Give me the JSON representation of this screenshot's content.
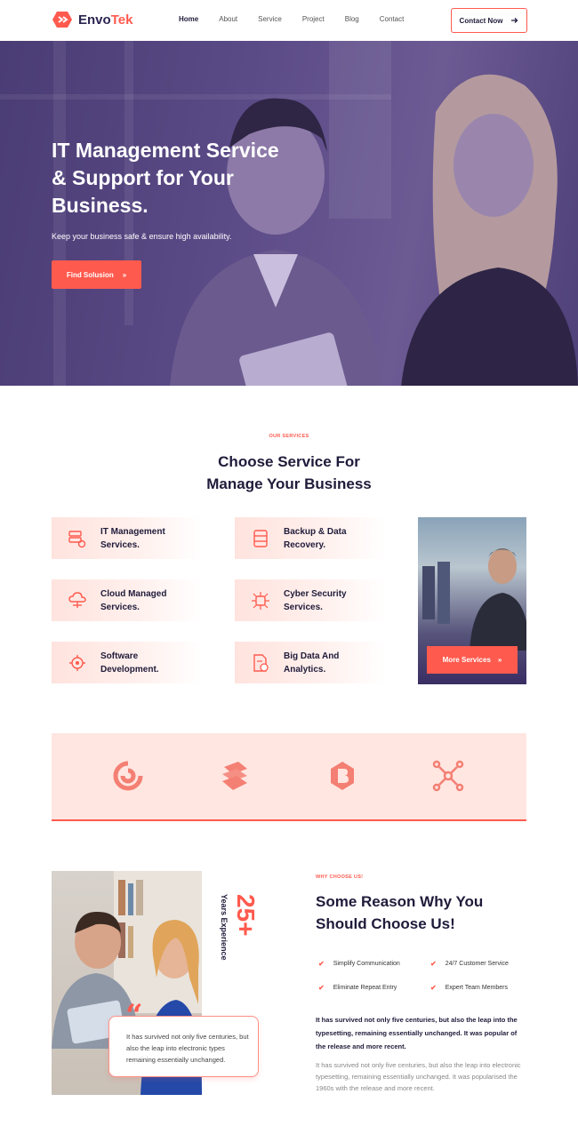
{
  "nav": {
    "brand_a": "Envo",
    "brand_b": "Tek",
    "items": [
      {
        "label": "Home"
      },
      {
        "label": "About"
      },
      {
        "label": "Service"
      },
      {
        "label": "Project"
      },
      {
        "label": "Blog"
      },
      {
        "label": "Contact"
      }
    ],
    "cta": "Contact Now",
    "cta_icon": "arrow-right-icon"
  },
  "hero": {
    "title": "IT Management Service & Support for Your Business.",
    "subtitle": "Keep your business safe & ensure high availability.",
    "button": "Find Solusion",
    "button_icon": "double-chevron-right-icon"
  },
  "services": {
    "eyebrow": "OUR SERVICES",
    "title_line1": "Choose Service For",
    "title_line2": "Manage Your Business",
    "cards": [
      {
        "line1": "IT Management",
        "line2": "Services.",
        "icon": "server-settings-icon"
      },
      {
        "line1": "Backup & Data",
        "line2": "Recovery.",
        "icon": "database-icon"
      },
      {
        "line1": "Cloud Managed",
        "line2": "Services.",
        "icon": "cloud-network-icon"
      },
      {
        "line1": "Cyber Security",
        "line2": "Services.",
        "icon": "security-chip-icon"
      },
      {
        "line1": "Software",
        "line2": "Development.",
        "icon": "gear-code-icon"
      },
      {
        "line1": "Big Data And",
        "line2": "Analytics.",
        "icon": "document-chart-icon"
      }
    ],
    "promo_button": "More Services",
    "promo_icon": "double-chevron-right-icon"
  },
  "brands": {
    "items": [
      "swirl-logo-icon",
      "stacked-layers-logo-icon",
      "b-badge-logo-icon",
      "network-nodes-logo-icon"
    ]
  },
  "why": {
    "years_num": "25+",
    "years_label": "Years Experience",
    "quote": "It has survived not only five centuries, but also the leap into electronic types remaining essentially unchanged.",
    "eyebrow": "WHY CHOOSE US!",
    "title_line1": "Some Reason Why You",
    "title_line2": "Should Choose Us!",
    "features": [
      "Simplify Communication",
      "24/7 Customer Service",
      "Eliminate Repeat Entry",
      "Expert Team Members"
    ],
    "bold_text": "It has survived not only five centuries, but also the leap into the typesetting, remaining essentially unchanged. It was popular of the release and more recent.",
    "para": "It has survived not only five centuries, but also the leap into electronic typesetting, remaining essentially unchanged. It was popularised the 1960s with the release and more recent."
  },
  "colors": {
    "accent": "#ff5a4e",
    "dark": "#1f1b3a",
    "hero_overlay": "#4a3c74",
    "card_bg": "#ffe3de"
  }
}
